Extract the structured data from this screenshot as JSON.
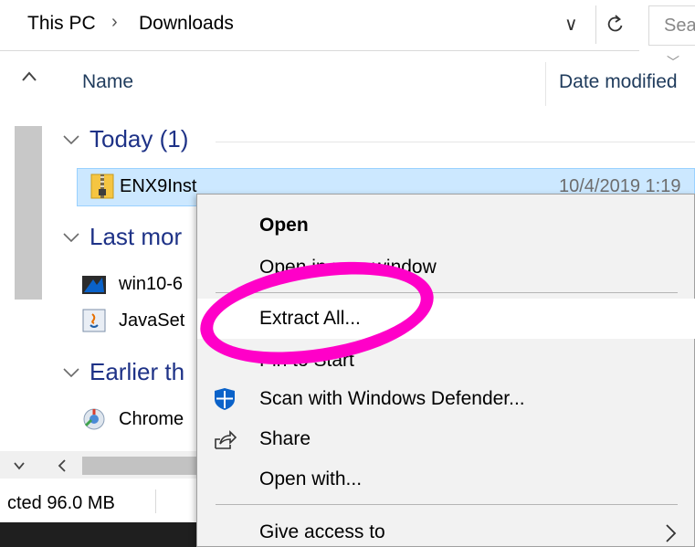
{
  "address_bar": {
    "crumbs": [
      "This PC",
      "Downloads"
    ],
    "separator": "›",
    "dropdown_glyph": "∨",
    "search_placeholder": "Sea"
  },
  "columns": {
    "name": "Name",
    "date_modified": "Date modified"
  },
  "groups": [
    {
      "label": "Today (1)"
    },
    {
      "label": "Last mor"
    },
    {
      "label": "Earlier th"
    }
  ],
  "files": [
    {
      "name": "ENX9Inst",
      "date": "10/4/2019 1:19",
      "icon": "zip-folder-icon",
      "selected": true
    },
    {
      "name": "win10-6",
      "icon": "media-creation-tool-icon"
    },
    {
      "name": "JavaSet",
      "icon": "java-setup-icon"
    },
    {
      "name": "Chrome",
      "icon": "chrome-installer-icon"
    }
  ],
  "status_bar": {
    "text": "cted 96.0 MB"
  },
  "context_menu": {
    "items": [
      {
        "label": "Open",
        "bold": true
      },
      {
        "label": "Open in new window"
      },
      {
        "label": "Extract All...",
        "highlighted": true
      },
      {
        "label": "Pin to Start"
      },
      {
        "label": "Scan with Windows Defender...",
        "icon": "windows-defender-icon"
      },
      {
        "label": "Share",
        "icon": "share-icon"
      },
      {
        "label": "Open with..."
      },
      {
        "label": "Give access to",
        "submenu": true
      }
    ]
  },
  "colors": {
    "selection_fill": "#cce8ff",
    "selection_border": "#99d1ff",
    "group_header": "#1e3287",
    "annotation_ring": "#ff00c8",
    "menu_background": "#f2f2f2"
  }
}
